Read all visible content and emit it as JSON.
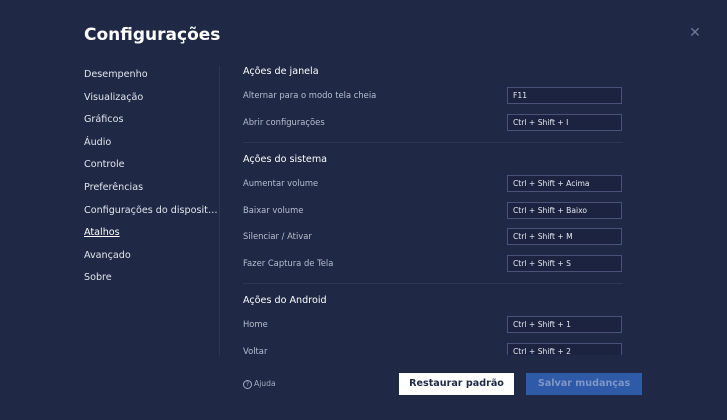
{
  "dialog": {
    "title": "Configurações",
    "close_icon": "close-icon"
  },
  "sidebar": {
    "items": [
      {
        "label": "Desempenho",
        "active": false
      },
      {
        "label": "Visualização",
        "active": false
      },
      {
        "label": "Gráficos",
        "active": false
      },
      {
        "label": "Áudio",
        "active": false
      },
      {
        "label": "Controle",
        "active": false
      },
      {
        "label": "Preferências",
        "active": false
      },
      {
        "label": "Configurações do dispositi...",
        "active": false
      },
      {
        "label": "Atalhos",
        "active": true
      },
      {
        "label": "Avançado",
        "active": false
      },
      {
        "label": "Sobre",
        "active": false
      }
    ]
  },
  "sections": [
    {
      "title": "Ações de janela",
      "rows": [
        {
          "label": "Alternar para o modo tela cheia",
          "key": "F11"
        },
        {
          "label": "Abrir configurações",
          "key": "Ctrl + Shift + I"
        }
      ]
    },
    {
      "title": "Ações do sistema",
      "rows": [
        {
          "label": "Aumentar volume",
          "key": "Ctrl + Shift + Acima"
        },
        {
          "label": "Baixar volume",
          "key": "Ctrl + Shift + Baixo"
        },
        {
          "label": "Silenciar / Ativar",
          "key": "Ctrl + Shift + M"
        },
        {
          "label": "Fazer Captura de Tela",
          "key": "Ctrl + Shift + S"
        }
      ]
    },
    {
      "title": "Ações do Android",
      "rows": [
        {
          "label": "Home",
          "key": "Ctrl + Shift + 1"
        },
        {
          "label": "Voltar",
          "key": "Ctrl + Shift + 2"
        }
      ]
    }
  ],
  "footer": {
    "help_label": "Ajuda",
    "restore_label": "Restaurar padrão",
    "save_label": "Salvar mudanças"
  },
  "colors": {
    "background": "#1f2845",
    "primary_button": "#2f5aa8",
    "field_border": "#4a5377"
  }
}
